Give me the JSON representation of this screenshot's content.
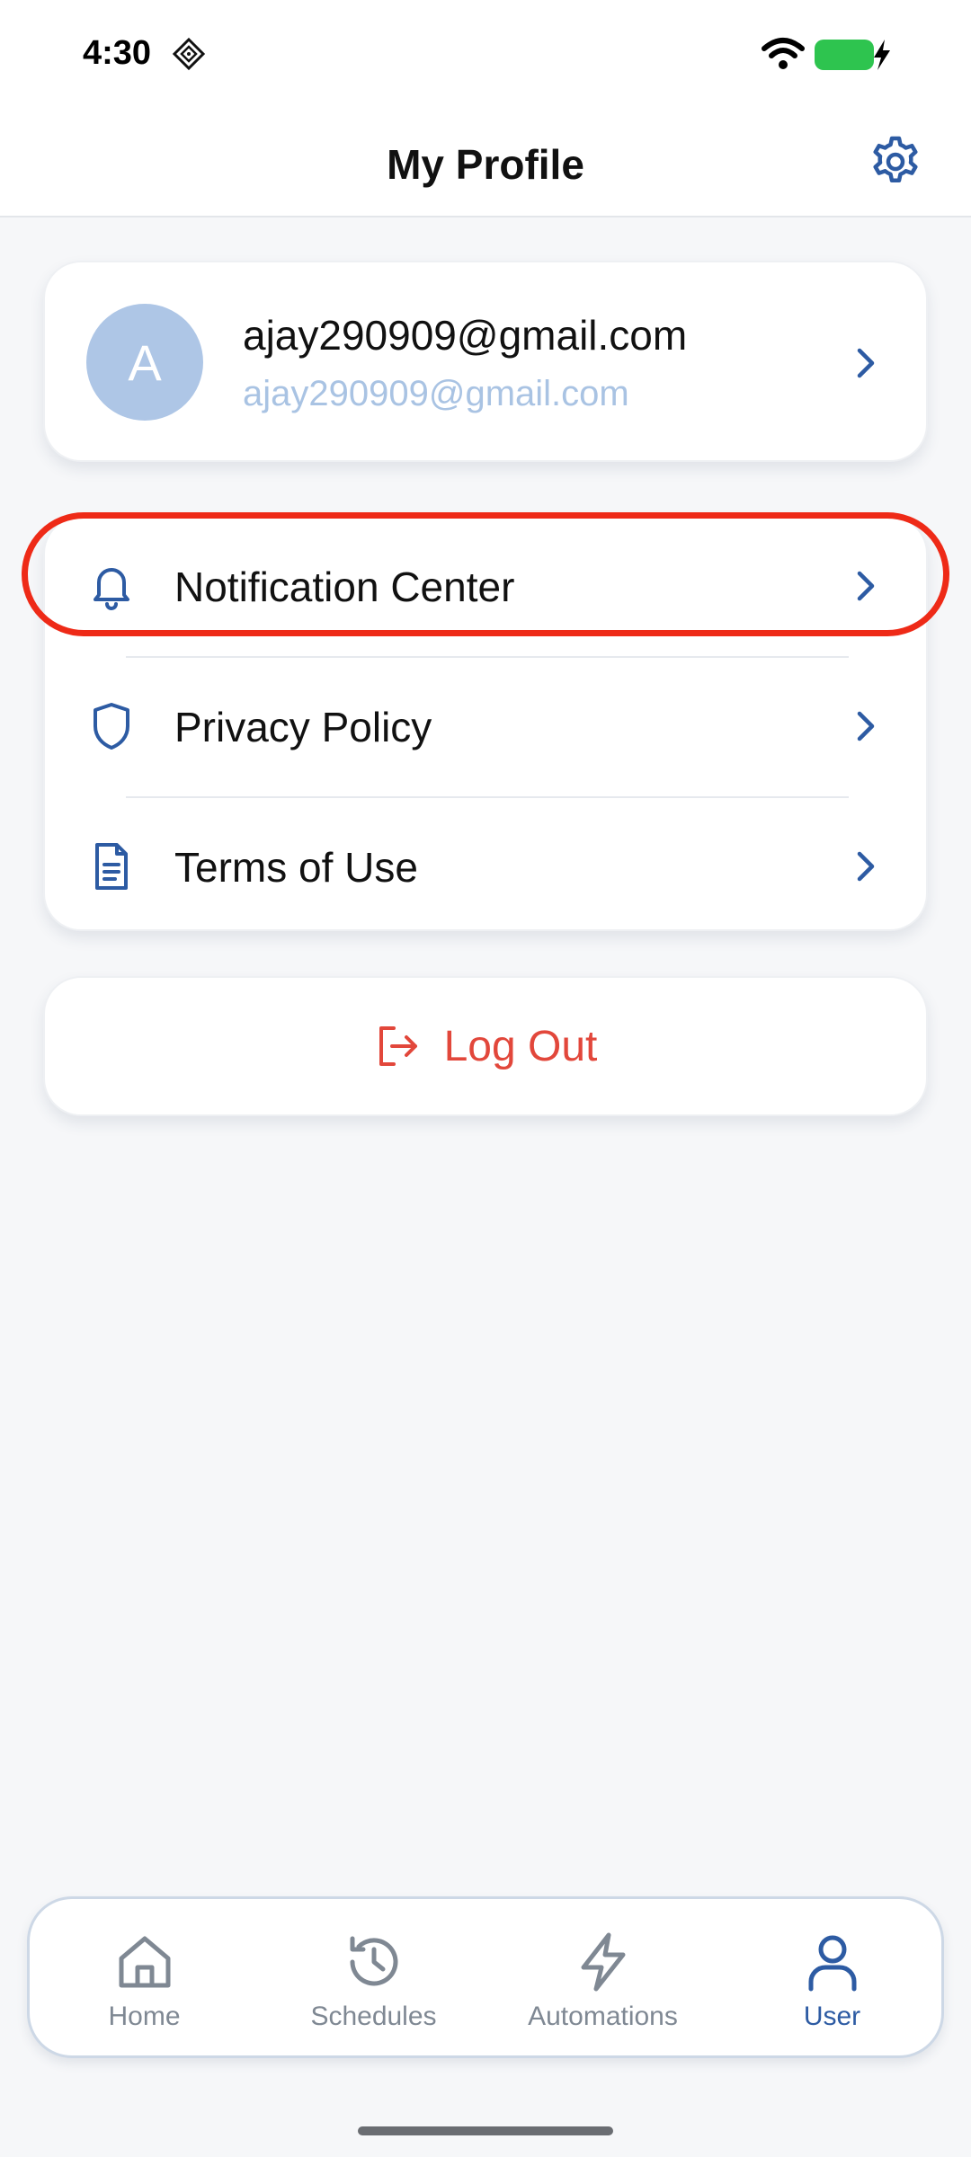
{
  "status_bar": {
    "time": "4:30"
  },
  "header": {
    "title": "My Profile"
  },
  "profile": {
    "avatar_letter": "A",
    "name": "ajay290909@gmail.com",
    "email": "ajay290909@gmail.com"
  },
  "menu": {
    "items": [
      {
        "label": "Notification Center",
        "icon": "bell-icon"
      },
      {
        "label": "Privacy Policy",
        "icon": "shield-icon"
      },
      {
        "label": "Terms of Use",
        "icon": "document-icon"
      }
    ]
  },
  "logout": {
    "label": "Log Out",
    "icon": "logout-icon"
  },
  "tabs": [
    {
      "label": "Home",
      "icon": "home-icon"
    },
    {
      "label": "Schedules",
      "icon": "history-icon"
    },
    {
      "label": "Automations",
      "icon": "lightning-icon"
    },
    {
      "label": "User",
      "icon": "user-icon",
      "active": true
    }
  ],
  "colors": {
    "accent": "#2d5ba3",
    "danger": "#e2473b",
    "highlight": "#ee2a17",
    "avatar_bg": "#aec6e6",
    "tab_inactive": "#7f8893"
  }
}
